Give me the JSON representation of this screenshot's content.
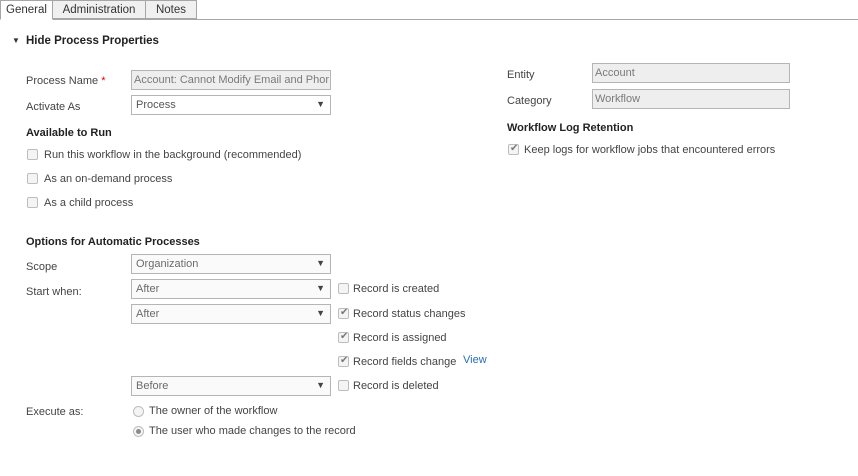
{
  "tabs": [
    {
      "label": "General",
      "active": true
    },
    {
      "label": "Administration",
      "active": false
    },
    {
      "label": "Notes",
      "active": false
    }
  ],
  "section": {
    "title": "Hide Process Properties"
  },
  "process_name": {
    "label": "Process Name",
    "required_mark": "*",
    "value": "Account: Cannot Modify Email and Phor"
  },
  "activate_as": {
    "label": "Activate As",
    "value": "Process"
  },
  "available_to_run": {
    "title": "Available to Run",
    "options": [
      {
        "label": "Run this workflow in the background (recommended)",
        "checked": false
      },
      {
        "label": "As an on-demand process",
        "checked": false
      },
      {
        "label": "As a child process",
        "checked": false
      }
    ]
  },
  "entity": {
    "label": "Entity",
    "value": "Account"
  },
  "category": {
    "label": "Category",
    "value": "Workflow"
  },
  "log_retention": {
    "title": "Workflow Log Retention",
    "keep_logs_label": "Keep logs for workflow jobs that encountered errors",
    "checked": true
  },
  "automatic": {
    "title": "Options for Automatic Processes",
    "scope": {
      "label": "Scope",
      "value": "Organization"
    },
    "start_when": {
      "label": "Start when:",
      "selects": [
        "After",
        "After",
        "Before"
      ],
      "triggers": [
        {
          "label": "Record is created",
          "checked": false
        },
        {
          "label": "Record status changes",
          "checked": true
        },
        {
          "label": "Record is assigned",
          "checked": true
        },
        {
          "label": "Record fields change",
          "checked": true,
          "link": "View"
        },
        {
          "label": "Record is deleted",
          "checked": false
        }
      ]
    },
    "execute_as": {
      "label": "Execute as:",
      "options": [
        {
          "label": "The owner of the workflow",
          "selected": false
        },
        {
          "label": "The user who made changes to the record",
          "selected": true
        }
      ]
    }
  },
  "icons": {
    "caret": "▼",
    "section_toggle": "▼",
    "check": "✔"
  }
}
